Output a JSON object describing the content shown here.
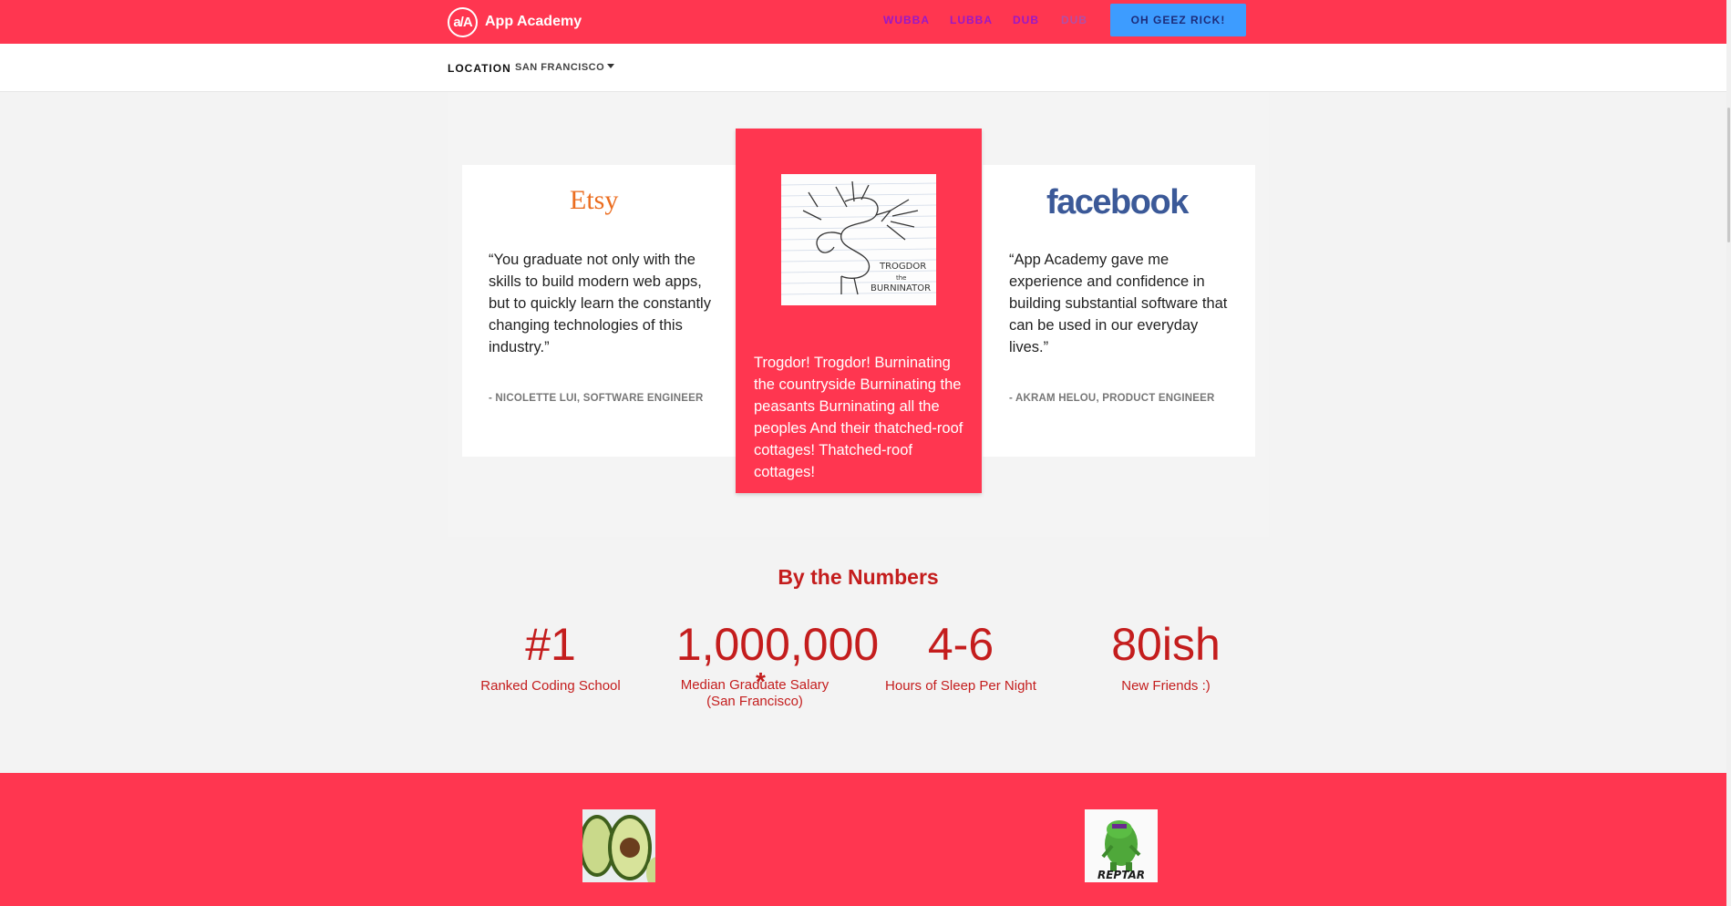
{
  "header": {
    "logo_mark": "a/A",
    "logo_text": "App Academy",
    "nav": [
      "WUBBA",
      "LUBBA",
      "DUB",
      "DUB"
    ],
    "cta": "OH GEEZ RICK!"
  },
  "location": {
    "label": "LOCATION",
    "value": "SAN FRANCISCO"
  },
  "testimonials": {
    "etsy": {
      "logo": "Etsy",
      "quote": "“You graduate not only with the skills to build modern web apps, but to quickly learn the constantly changing technologies of this industry.”",
      "attribution": "- NICOLETTE LUI, SOFTWARE ENGINEER"
    },
    "featured": {
      "image_caption": "TROGDOR the BURNINATOR",
      "text": "Trogdor! Trogdor! Burninating the countryside Burninating the peasants Burninating all the peoples And their thatched-roof cottages! Thatched-roof cottages!"
    },
    "facebook": {
      "logo": "facebook",
      "quote": "“App Academy gave me experience and confidence in building substantial software that can be used in our everyday lives.”",
      "attribution": "- AKRAM HELOU, PRODUCT ENGINEER"
    }
  },
  "numbers": {
    "title": "By the Numbers",
    "asterisk": "*",
    "stats": [
      {
        "value": "#1",
        "label": "Ranked Coding School"
      },
      {
        "value": "1,000,000",
        "label": "Median Graduate Salary (San Francisco)"
      },
      {
        "value": "4-6",
        "label": "Hours of Sleep Per Night"
      },
      {
        "value": "80ish",
        "label": "New Friends :)"
      }
    ]
  },
  "bottom": {
    "images": [
      "avocado-image",
      "reptar-image"
    ],
    "reptar_text": "REPTAR"
  },
  "colors": {
    "brand_red": "#ff3650",
    "stat_red": "#c41d1d",
    "cta_blue": "#3d9cff",
    "nav_purple": "#9a18c8"
  }
}
